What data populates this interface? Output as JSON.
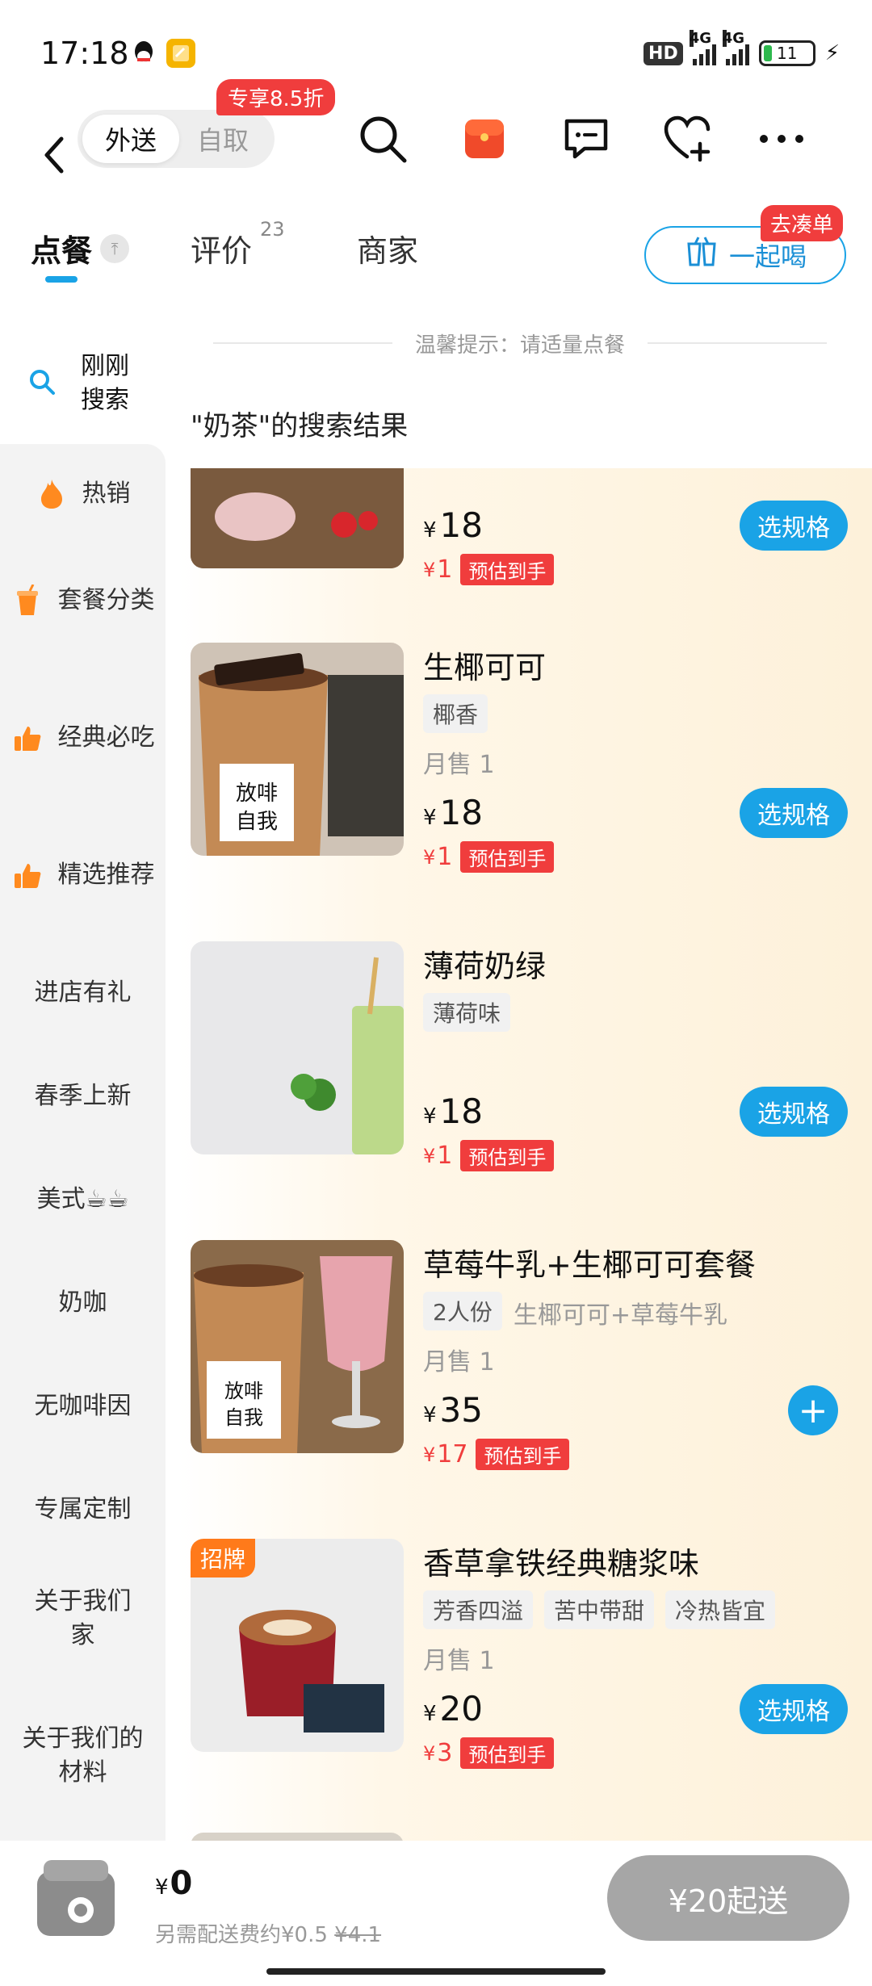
{
  "status_bar": {
    "time": "17:18",
    "hd": "HD",
    "net1": "4G",
    "net2": "4G",
    "battery": "11"
  },
  "nav": {
    "mode_delivery": "外送",
    "mode_pickup": "自取",
    "promo_badge": "专享8.5折"
  },
  "tabs": {
    "order": "点餐",
    "reviews": "评价",
    "reviews_count": "23",
    "merchant": "商家",
    "together_label": "一起喝",
    "together_badge": "去凑单"
  },
  "tip": "温馨提示：请适量点餐",
  "results_title": "\"奶茶\"的搜索结果",
  "sidebar": {
    "search_label": "刚刚搜索",
    "items": [
      {
        "label": "热销",
        "icon": "flame-icon"
      },
      {
        "label": "套餐分类",
        "icon": "drink-cup-icon"
      },
      {
        "label": "经典必吃",
        "icon": "thumbs-up-icon"
      },
      {
        "label": "精选推荐",
        "icon": "thumbs-up-icon"
      },
      {
        "label": "进店有礼"
      },
      {
        "label": "春季上新"
      },
      {
        "label": "美式☕☕"
      },
      {
        "label": "奶咖"
      },
      {
        "label": "无咖啡因"
      },
      {
        "label": "专属定制"
      },
      {
        "label": "关于我们家"
      },
      {
        "label": "关于我们的材料"
      }
    ]
  },
  "products": [
    {
      "name": "",
      "price": "18",
      "estimate": "1",
      "estimate_tag": "预估到手",
      "button": "选规格"
    },
    {
      "name": "生椰可可",
      "tags": [
        "椰香"
      ],
      "sales": "月售 1",
      "price": "18",
      "estimate": "1",
      "estimate_tag": "预估到手",
      "button": "选规格"
    },
    {
      "name": "薄荷奶绿",
      "tags": [
        "薄荷味"
      ],
      "price": "18",
      "estimate": "1",
      "estimate_tag": "预估到手",
      "button": "选规格"
    },
    {
      "name": "草莓牛乳+生椰可可套餐",
      "tags": [
        "2人份"
      ],
      "desc": "生椰可可+草莓牛乳",
      "sales": "月售 1",
      "price": "35",
      "estimate": "17",
      "estimate_tag": "预估到手",
      "button": "+"
    },
    {
      "name": "香草拿铁经典糖浆味",
      "badge": "招牌",
      "tags": [
        "芳香四溢",
        "苦中带甜",
        "冷热皆宜"
      ],
      "sales": "月售 1",
      "price": "20",
      "estimate": "3",
      "estimate_tag": "预估到手",
      "button": "选规格"
    }
  ],
  "currency": "¥",
  "cart": {
    "total": "0",
    "fee_text": "另需配送费约¥0.5",
    "fee_original": "¥4.1",
    "min_order": "¥20起送"
  },
  "colors": {
    "accent": "#1aa3e6",
    "promo_red": "#f03d3d",
    "signature_orange": "#ff7a1a"
  }
}
